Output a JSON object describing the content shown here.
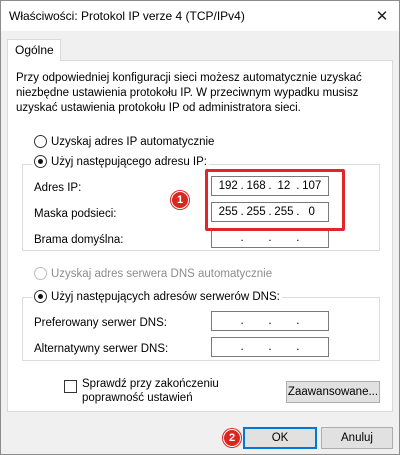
{
  "window": {
    "title": "Właściwości: Protokol IP verze 4 (TCP/IPv4)",
    "close_glyph": "✕"
  },
  "tab": {
    "label": "Ogólne"
  },
  "description": "Przy odpowiedniej konfiguracji sieci możesz automatycznie uzyskać niezbędne ustawienia protokołu IP. W przeciwnym wypadku musisz uzyskać ustawienia protokołu IP od administratora sieci.",
  "ip": {
    "auto_label": "Uzyskaj adres IP automatycznie",
    "manual_label": "Użyj następującego adresu IP:",
    "auto_selected": false,
    "manual_selected": true,
    "address_label": "Adres IP:",
    "address": [
      "192",
      "168",
      "12",
      "107"
    ],
    "mask_label": "Maska podsieci:",
    "mask": [
      "255",
      "255",
      "255",
      "0"
    ],
    "gateway_label": "Brama domyślna:",
    "gateway": [
      "",
      "",
      "",
      ""
    ]
  },
  "dns": {
    "auto_label": "Uzyskaj adres serwera DNS automatycznie",
    "manual_label": "Użyj następujących adresów serwerów DNS:",
    "auto_selected": false,
    "auto_disabled": true,
    "manual_selected": true,
    "preferred_label": "Preferowany serwer DNS:",
    "preferred": [
      "",
      "",
      "",
      ""
    ],
    "alternate_label": "Alternatywny serwer DNS:",
    "alternate": [
      "",
      "",
      "",
      ""
    ]
  },
  "validate": {
    "label": "Sprawdź przy zakończeniu poprawność ustawień",
    "checked": false
  },
  "buttons": {
    "advanced": "Zaawansowane...",
    "ok": "OK",
    "cancel": "Anuluj"
  },
  "annotations": {
    "badge1": "1",
    "badge2": "2",
    "color": "#e0262a"
  },
  "colors": {
    "accent": "#0078d7",
    "highlight": "#e0262a"
  }
}
